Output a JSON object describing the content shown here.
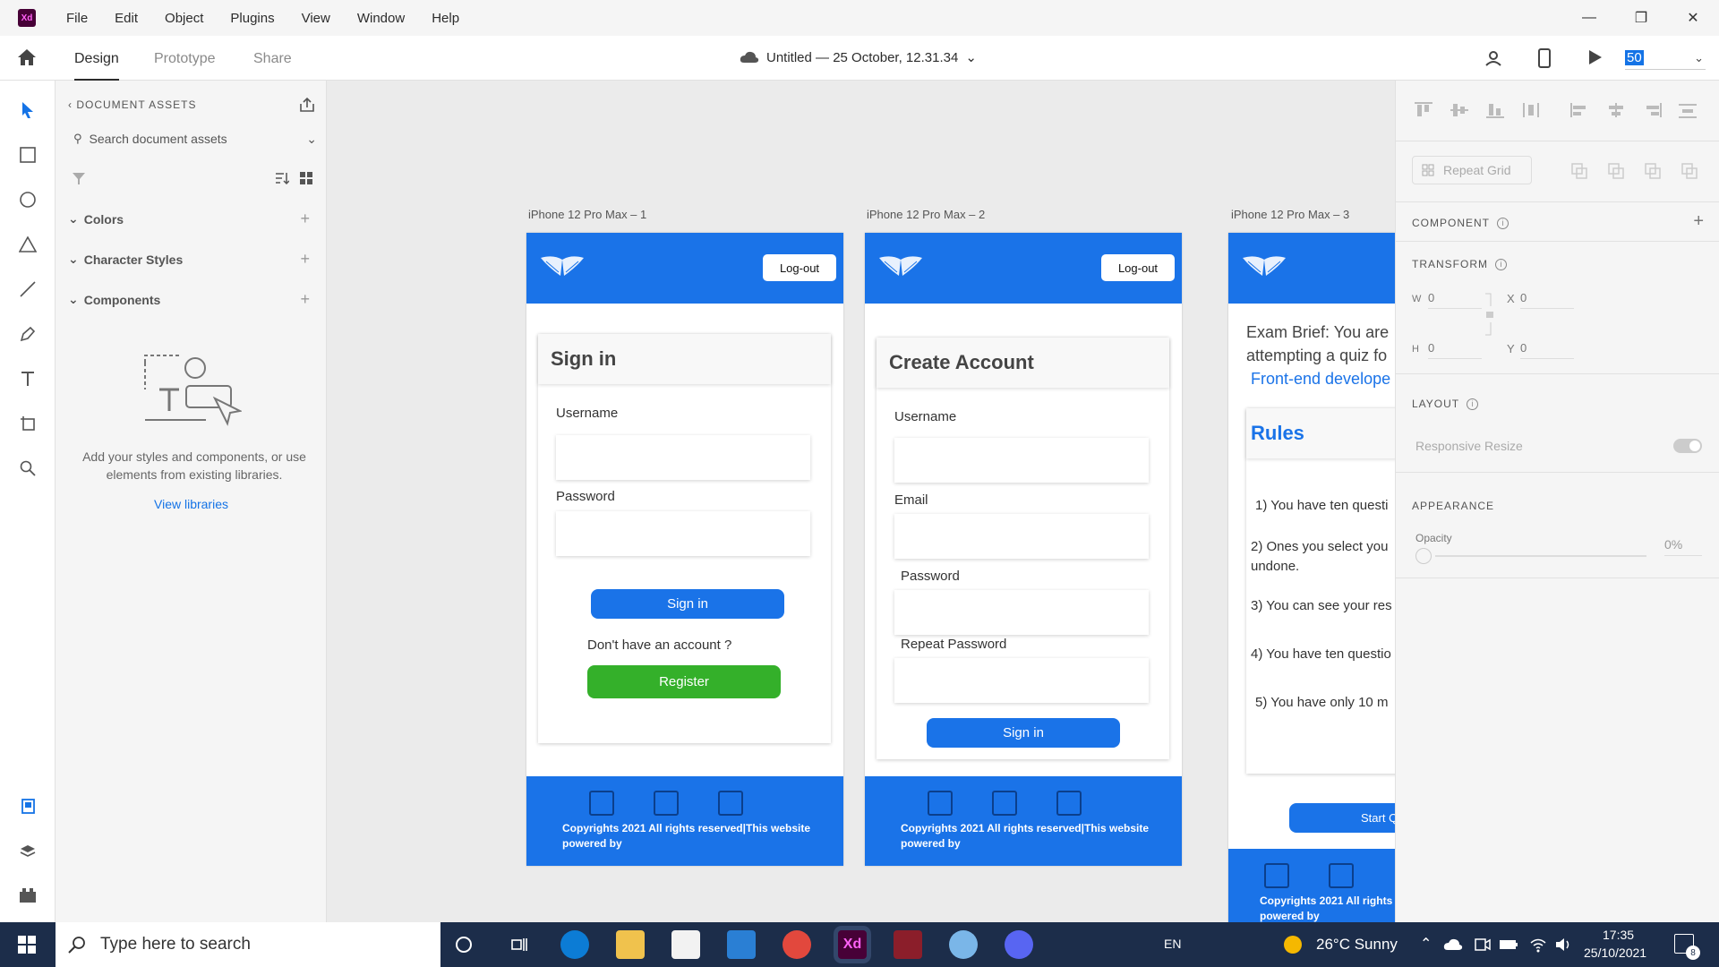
{
  "app": {
    "logo_text": "Xd",
    "menu": [
      "File",
      "Edit",
      "Object",
      "Plugins",
      "View",
      "Window",
      "Help"
    ],
    "window_controls": [
      "—",
      "❐",
      "✕"
    ]
  },
  "appbar": {
    "tabs": [
      "Design",
      "Prototype",
      "Share"
    ],
    "doc_title": "Untitled — 25 October, 12.31.34",
    "zoom": "50"
  },
  "assets": {
    "header": "DOCUMENT ASSETS",
    "search_placeholder": "Search document assets",
    "sections": [
      "Colors",
      "Character Styles",
      "Components"
    ],
    "empty_text": "Add your styles and components, or use elements from existing libraries.",
    "view_libraries": "View libraries"
  },
  "artboards": [
    {
      "label": "iPhone 12 Pro Max – 1",
      "logout": "Log-out",
      "title": "Sign in",
      "username_label": "Username",
      "password_label": "Password",
      "signin_button": "Sign in",
      "no_account_text": "Don't have an account ?",
      "register_button": "Register",
      "footer_text": "Copyrights  2021 All rights reserved|This website powered by"
    },
    {
      "label": "iPhone 12 Pro Max – 2",
      "logout": "Log-out",
      "title": "Create Account",
      "username_label": "Username",
      "email_label": "Email",
      "password_label": "Password",
      "repeat_password_label": "Repeat Password",
      "signin_button": "Sign in",
      "footer_text": "Copyrights  2021 All rights reserved|This website powered by"
    },
    {
      "label": "iPhone 12 Pro Max – 3",
      "brief_line1": "Exam Brief: You are",
      "brief_line2": "attempting a quiz fo",
      "brief_role": "Front-end develope",
      "rules_title": "Rules",
      "rules": [
        "1) You have ten questi",
        "2) Ones you select you undone.",
        "3) You can see your res",
        "4) You have ten questio",
        "5) You have only 10 m"
      ],
      "start_button": "Start Q",
      "footer_text": "Copyrights  2021 All rights powered by"
    }
  ],
  "properties": {
    "repeat_grid": "Repeat Grid",
    "component_title": "COMPONENT",
    "transform_title": "TRANSFORM",
    "w_label": "W",
    "w_value": "0",
    "x_label": "X",
    "x_value": "0",
    "h_label": "H",
    "h_value": "0",
    "y_label": "Y",
    "y_value": "0",
    "layout_title": "LAYOUT",
    "responsive_resize": "Responsive Resize",
    "appearance_title": "APPEARANCE",
    "opacity_label": "Opacity",
    "opacity_value": "0%"
  },
  "taskbar": {
    "search_placeholder": "Type here to search",
    "language": "EN",
    "weather": "26°C  Sunny",
    "time": "17:35",
    "date": "25/10/2021",
    "notifications": "8"
  },
  "colors": {
    "brand_blue": "#1a73e8",
    "register_green": "#34b02a",
    "accent": "#1473e6"
  }
}
